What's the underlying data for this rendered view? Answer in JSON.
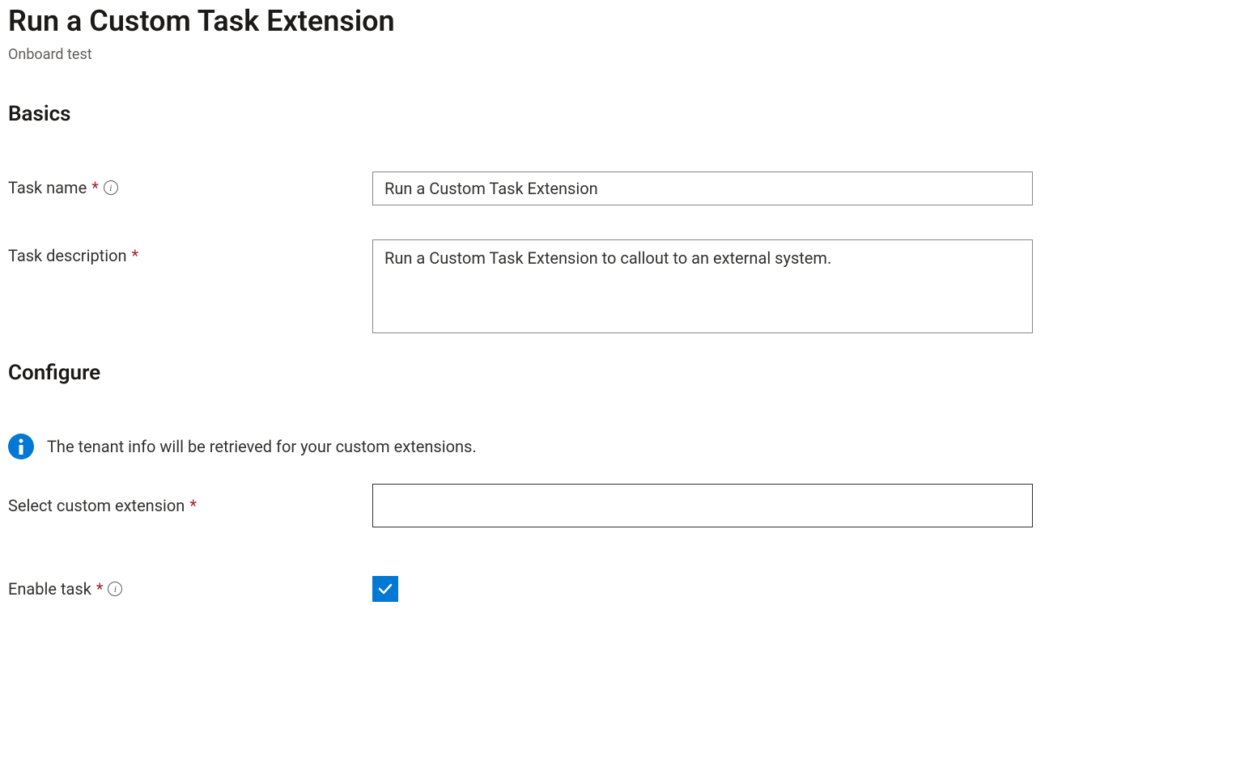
{
  "header": {
    "title": "Run a Custom Task Extension",
    "subtitle": "Onboard test"
  },
  "sections": {
    "basics": "Basics",
    "configure": "Configure"
  },
  "fields": {
    "task_name": {
      "label": "Task name",
      "value": "Run a Custom Task Extension"
    },
    "task_description": {
      "label": "Task description",
      "value": "Run a Custom Task Extension to callout to an external system."
    },
    "select_extension": {
      "label": "Select custom extension",
      "value": ""
    },
    "enable_task": {
      "label": "Enable task",
      "checked": true
    }
  },
  "info_banner": "The tenant info will be retrieved for your custom extensions."
}
